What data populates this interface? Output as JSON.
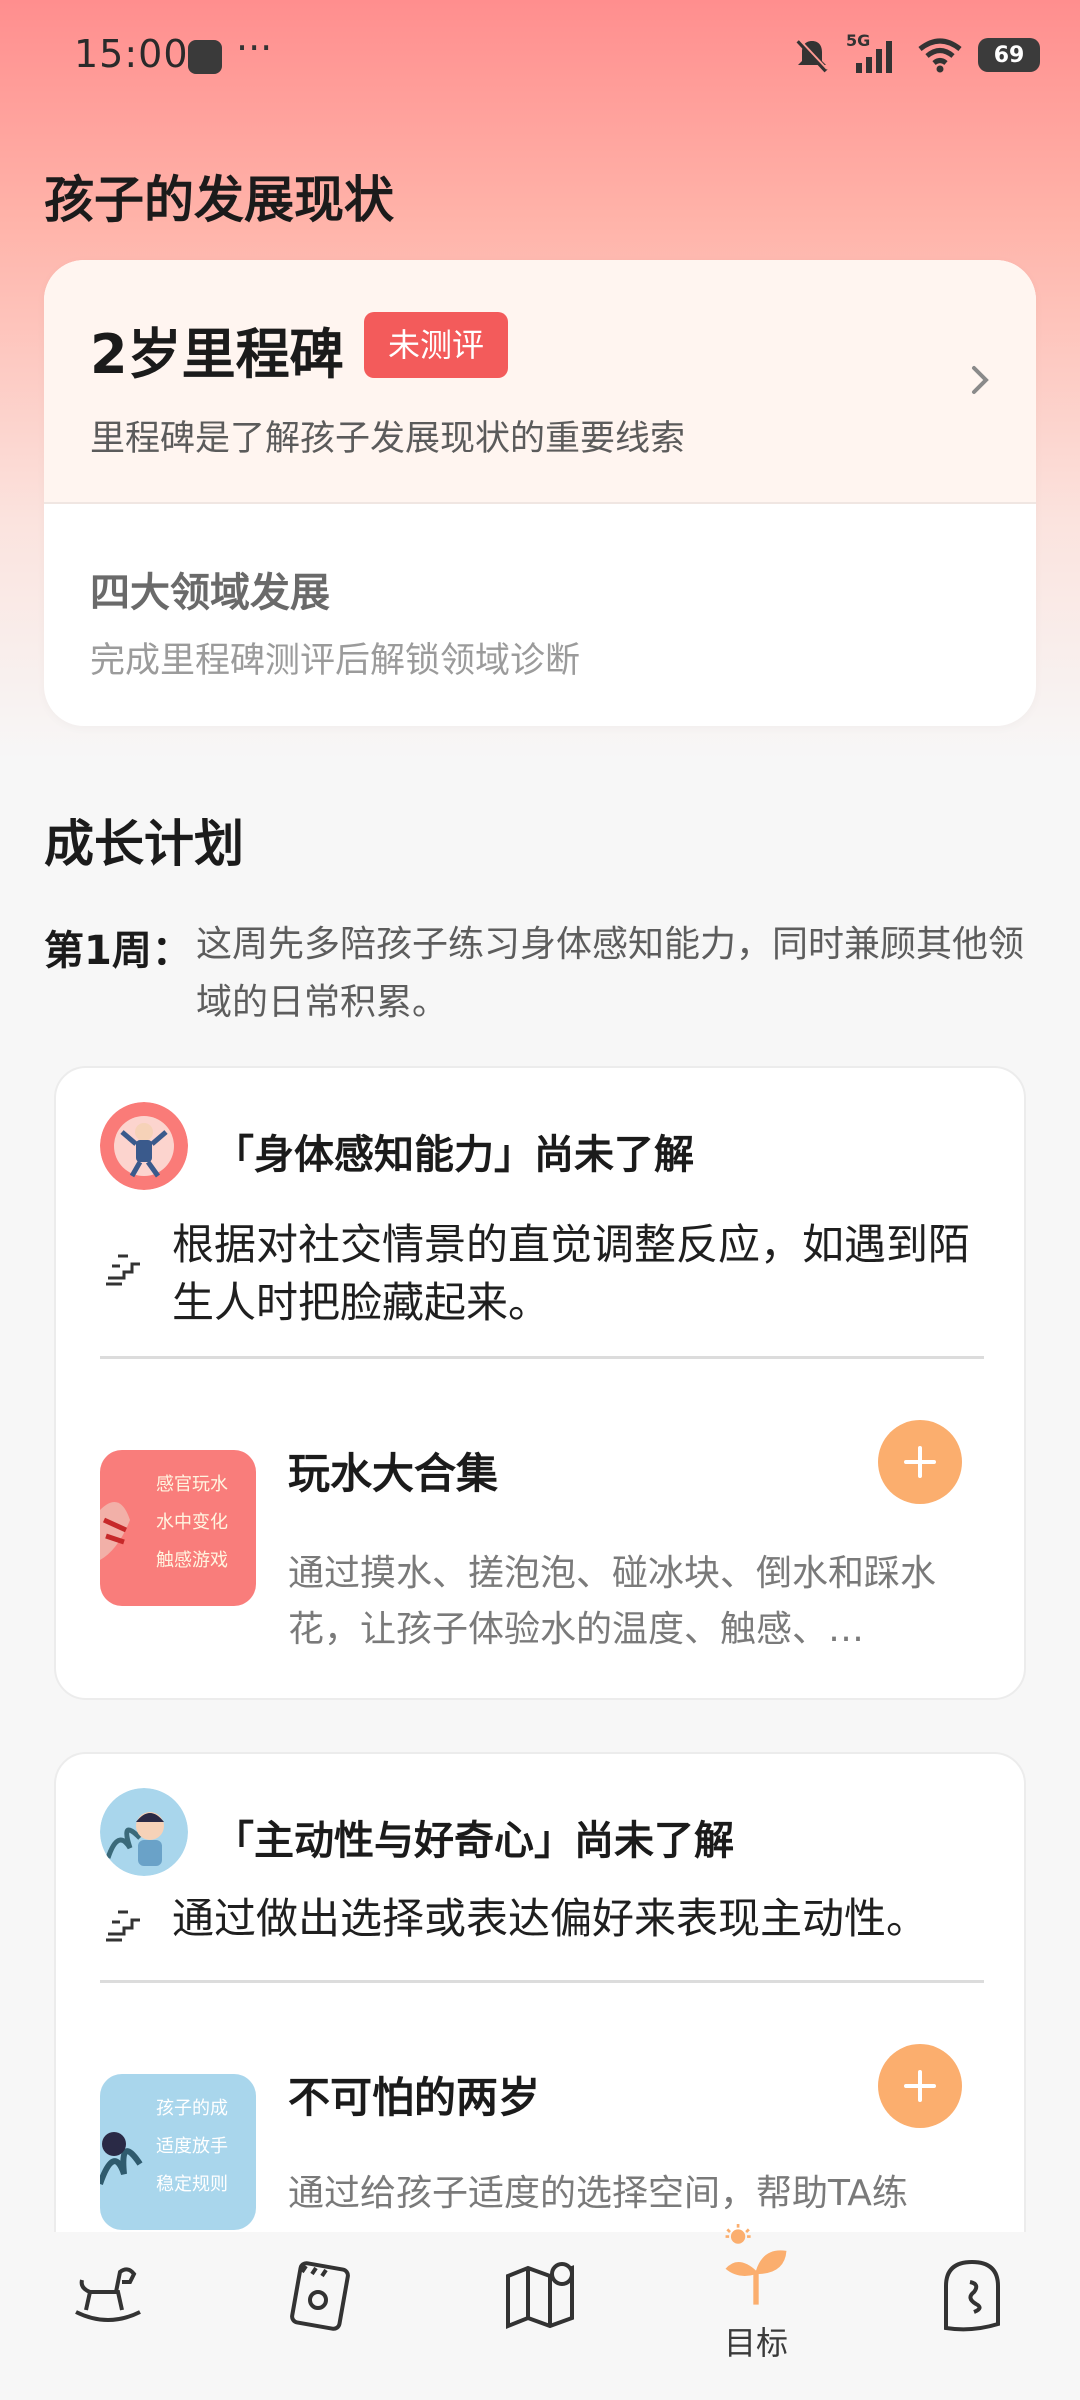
{
  "status_bar": {
    "time": "15:00",
    "more": "···",
    "signal_label": "5G",
    "battery": "69"
  },
  "development": {
    "heading": "孩子的发展现状",
    "milestone": {
      "title": "2岁里程碑",
      "badge": "未测评",
      "desc": "里程碑是了解孩子发展现状的重要线索"
    },
    "domains": {
      "title": "四大领域发展",
      "desc": "完成里程碑测评后解锁领域诊断"
    }
  },
  "plan": {
    "heading": "成长计划",
    "week_label": "第1周：",
    "week_text": "这周先多陪孩子练习身体感知能力，同时兼顾其他领域的日常积累。",
    "cards": [
      {
        "title": "「身体感知能力」尚未了解",
        "goal": "根据对社交情景的直觉调整反应，如遇到陌生人时把脸藏起来。",
        "activity_title": "玩水大合集",
        "activity_desc": "通过摸水、搓泡泡、碰冰块、倒水和踩水花，让孩子体验水的温度、触感、…",
        "thumb_lines": [
          "感官玩水",
          "水中变化",
          "触感游戏"
        ]
      },
      {
        "title": "「主动性与好奇心」尚未了解",
        "goal": "通过做出选择或表达偏好来表现主动性。",
        "activity_title": "不可怕的两岁",
        "activity_desc": "通过给孩子适度的选择空间，帮助TA练",
        "thumb_lines": [
          "孩子的成",
          "适度放手",
          "稳定规则"
        ]
      }
    ]
  },
  "nav": {
    "items": [
      {
        "name": "horse"
      },
      {
        "name": "notebook"
      },
      {
        "name": "map"
      },
      {
        "name": "target",
        "label": "目标"
      },
      {
        "name": "profile"
      }
    ]
  },
  "colors": {
    "accent": "#fbae6e",
    "badge": "#f35b5b",
    "header_gradient_top": "#ff8e8e"
  }
}
